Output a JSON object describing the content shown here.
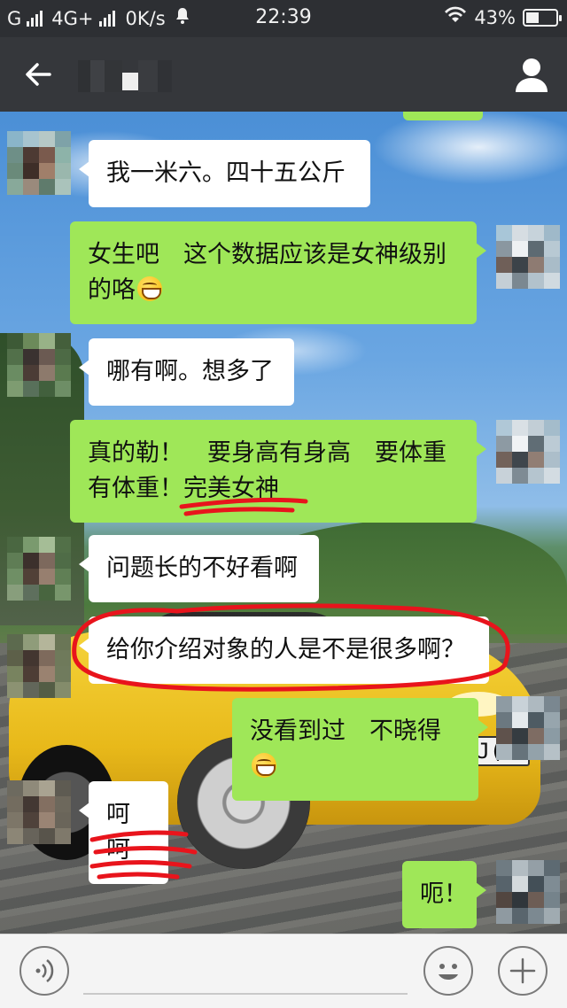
{
  "status_bar": {
    "carrier_left": "G",
    "network": "4G+",
    "speed": "0K/s",
    "time": "22:39",
    "battery": "43%",
    "battery_level": 0.43
  },
  "header": {
    "back_icon": "arrow-left-icon",
    "profile_icon": "person-icon"
  },
  "messages": [
    {
      "side": "in",
      "text": "我一米六。四十五公斤"
    },
    {
      "side": "out",
      "text": "女生吧　这个数据应该是女神级别的咯"
    },
    {
      "side": "in",
      "text": "哪有啊。想多了"
    },
    {
      "side": "out",
      "text_line1": "真的勒！　要身高有身高　要体重",
      "text_line2_a": "有体重！",
      "text_line2_b": "完美女神"
    },
    {
      "side": "in",
      "text": "问题长的不好看啊"
    },
    {
      "side": "in",
      "text": "给你介绍对象的人是不是很多啊？"
    },
    {
      "side": "out",
      "text": "没看到过　不晓得"
    },
    {
      "side": "in",
      "text": "呵呵"
    },
    {
      "side": "out",
      "text": "呃！"
    }
  ],
  "background": {
    "plate_text": "RJ("
  },
  "input_bar": {
    "voice_icon": "voice-icon",
    "emoji_icon": "smiley-icon",
    "plus_icon": "plus-icon",
    "input_value": ""
  },
  "colors": {
    "outgoing_bubble": "#9fe758",
    "incoming_bubble": "#ffffff",
    "annotation_red": "#e8141c"
  }
}
